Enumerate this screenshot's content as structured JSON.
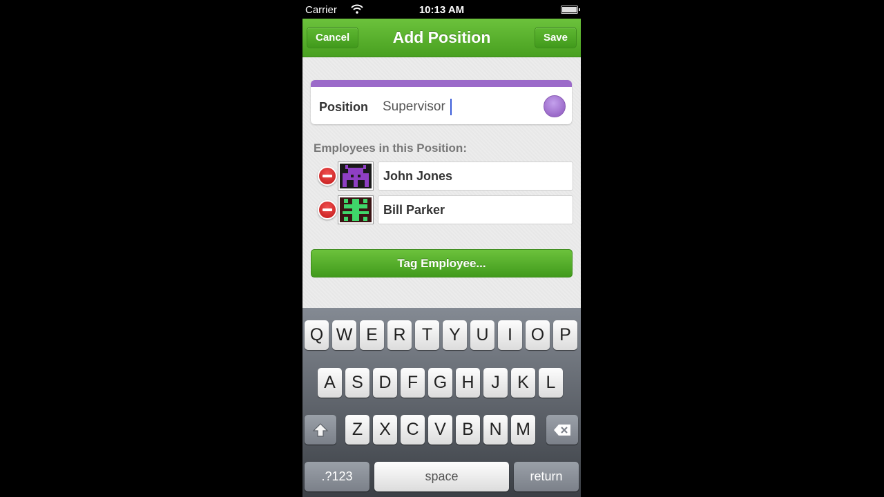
{
  "status_bar": {
    "carrier": "Carrier",
    "time": "10:13 AM"
  },
  "nav": {
    "title": "Add Position",
    "cancel_label": "Cancel",
    "save_label": "Save",
    "color": "#52aa28"
  },
  "position": {
    "label": "Position",
    "value": "Supervisor",
    "color": "#9b6ac9"
  },
  "employees": {
    "header": "Employees in this Position:",
    "list": [
      {
        "name": "John Jones",
        "avatar_color": "#8f3fc4"
      },
      {
        "name": "Bill Parker",
        "avatar_color": "#3fd66a"
      }
    ]
  },
  "tag_button_label": "Tag Employee...",
  "keyboard": {
    "row1": [
      "Q",
      "W",
      "E",
      "R",
      "T",
      "Y",
      "U",
      "I",
      "O",
      "P"
    ],
    "row2": [
      "A",
      "S",
      "D",
      "F",
      "G",
      "H",
      "J",
      "K",
      "L"
    ],
    "row3": [
      "Z",
      "X",
      "C",
      "V",
      "B",
      "N",
      "M"
    ],
    "numbers_label": ".?123",
    "space_label": "space",
    "return_label": "return",
    "shift_icon": "shift-icon",
    "backspace_icon": "backspace-icon"
  }
}
